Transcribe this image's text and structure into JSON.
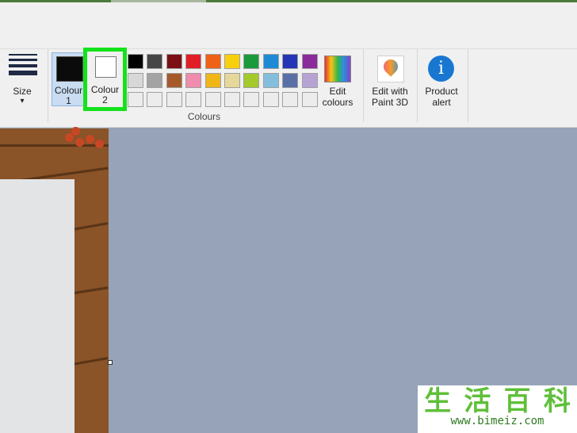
{
  "toolbar": {
    "size_label": "Size",
    "colour1_line1": "Colour",
    "colour1_line2": "1",
    "colour2_line1": "Colour",
    "colour2_line2": "2",
    "edit_colours_line1": "Edit",
    "edit_colours_line2": "colours",
    "edit_paint3d_line1": "Edit with",
    "edit_paint3d_line2": "Paint 3D",
    "product_alert_line1": "Product",
    "product_alert_line2": "alert",
    "group_label": "Colours",
    "info_glyph": "i",
    "size_arrow": "▾"
  },
  "colors": {
    "highlight": "#14e21c",
    "colour1": "#0b0b0b",
    "colour2": "#ffffff"
  },
  "palette": [
    [
      "#000000",
      "#464646",
      "#7b0f14",
      "#e01f26",
      "#ef6116",
      "#f7d00d",
      "#1b9a3b",
      "#1e8ad6",
      "#2635b5",
      "#8a2a9b"
    ],
    [
      "#d8d8d8",
      "#a3a3a3",
      "#a65a2a",
      "#f08cae",
      "#f0b516",
      "#e6d79a",
      "#a4c92a",
      "#84bedd",
      "#5a6fa6",
      "#b6a3d4"
    ],
    [
      "#ececec",
      "#ececec",
      "#ececec",
      "#ececec",
      "#ececec",
      "#ececec",
      "#ececec",
      "#ececec",
      "#ececec",
      "#ececec"
    ]
  ],
  "watermark": {
    "chars": [
      "生",
      "活",
      "百",
      "科"
    ],
    "url": "www.bimeiz.com"
  }
}
